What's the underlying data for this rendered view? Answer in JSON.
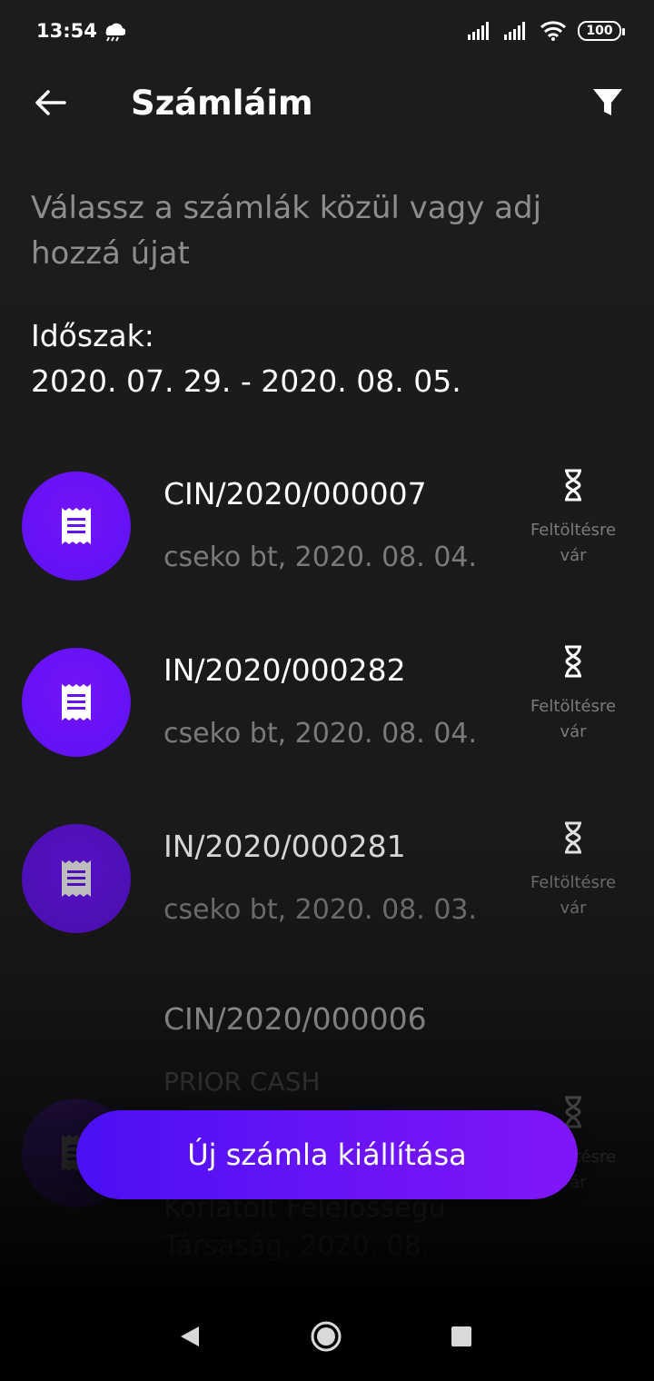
{
  "status_bar": {
    "time": "13:54",
    "battery": "100",
    "icons": [
      "weather-icon",
      "signal-icon",
      "signal-icon",
      "wifi-icon",
      "battery-icon"
    ]
  },
  "header": {
    "title": "Számláim",
    "back_icon": "arrow-left-icon",
    "filter_icon": "filter-icon"
  },
  "intro": {
    "subtitle": "Válassz a számlák közül vagy adj hozzá újat",
    "period_label": "Időszak:",
    "period_range": "2020. 07. 29. - 2020. 08. 05."
  },
  "invoices": [
    {
      "number": "CIN/2020/000007",
      "meta": "cseko bt, 2020. 08. 04.",
      "status": "Feltöltésre vár"
    },
    {
      "number": "IN/2020/000282",
      "meta": "cseko bt, 2020. 08. 04.",
      "status": "Feltöltésre vár"
    },
    {
      "number": "IN/2020/000281",
      "meta": "cseko bt, 2020. 08. 03.",
      "status": "Feltöltésre vár"
    },
    {
      "number": "CIN/2020/000006",
      "meta_lines": [
        "PRIOR CASH",
        "Korlátolt Felelősségű",
        "Társaság, 2020. 08."
      ],
      "status": "Feltöltésre vár"
    }
  ],
  "cta": {
    "label": "Új számla kiállítása"
  },
  "nav": {
    "back_icon": "nav-back-icon",
    "home_icon": "nav-home-icon",
    "recents_icon": "nav-recents-icon"
  },
  "colors": {
    "accent": "#6a14f6",
    "avatar_bright": "#6d12f7",
    "avatar_dim": "#4d0fb8",
    "muted_text": "#7a7a7a"
  }
}
